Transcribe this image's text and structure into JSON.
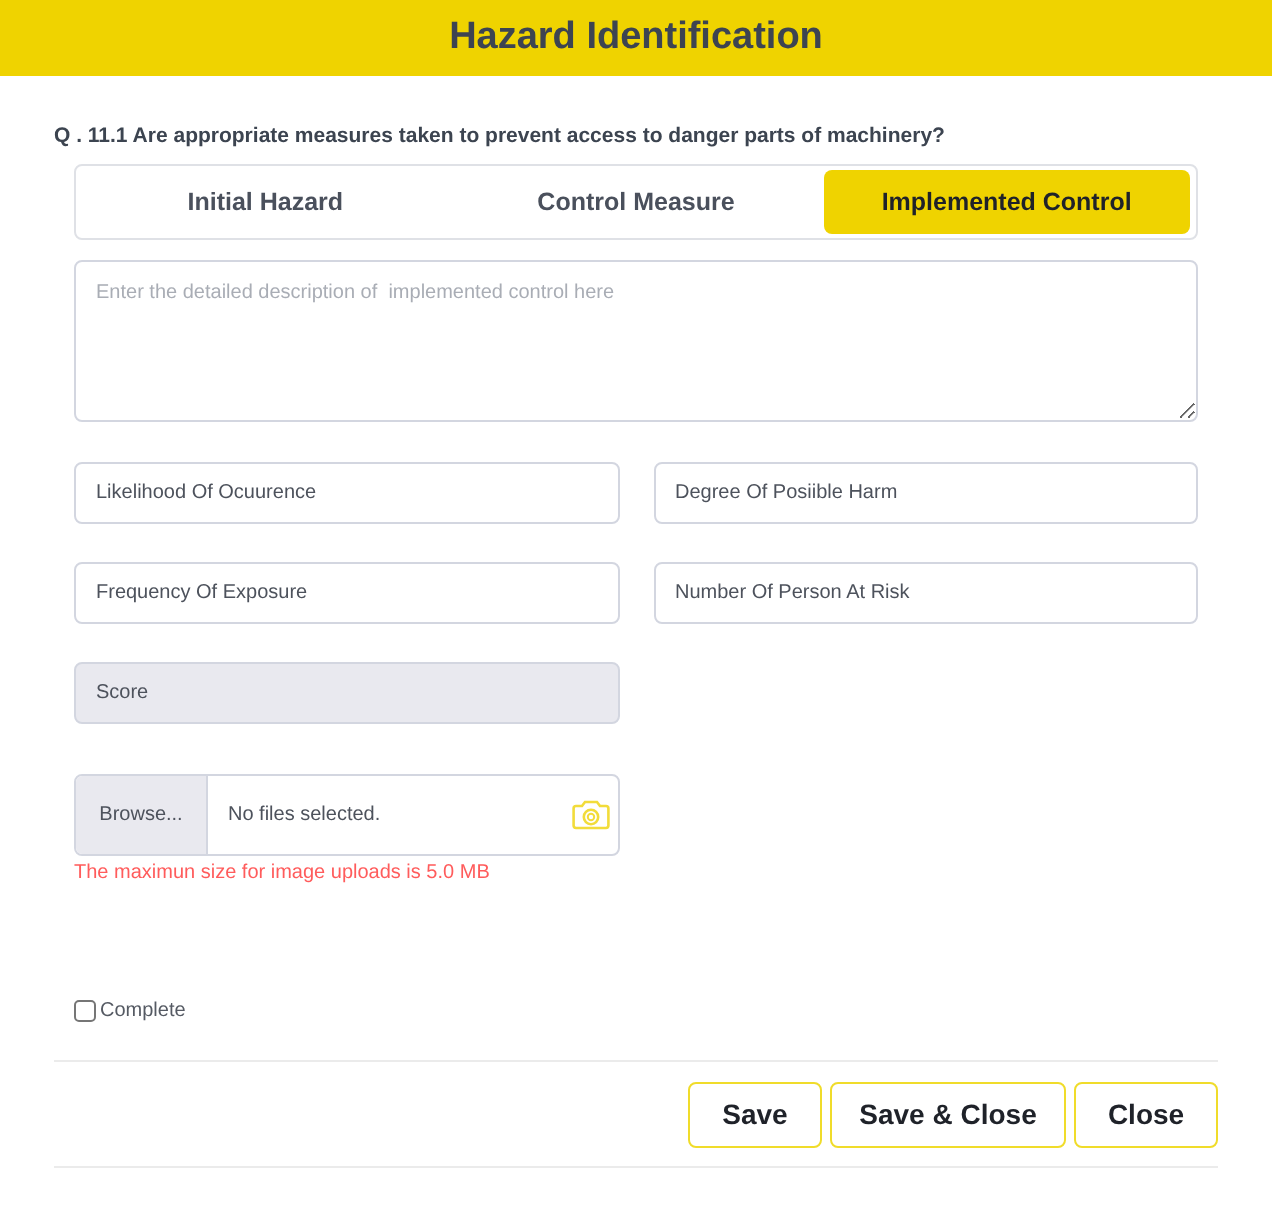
{
  "window": {
    "title": "Hazard Identification"
  },
  "question": "Q . 11.1 Are appropriate measures taken to prevent access to danger parts of machinery?",
  "tabs": [
    {
      "label": "Initial Hazard",
      "selected": false
    },
    {
      "label": "Control Measure",
      "selected": false
    },
    {
      "label": "Implemented Control",
      "selected": true
    }
  ],
  "description": {
    "placeholder": "Enter the detailed description of  implemented control here"
  },
  "fields": [
    {
      "value": "Likelihood Of Ocuurence",
      "disabled": false
    },
    {
      "value": "Degree Of Posiible Harm",
      "disabled": false
    },
    {
      "value": "Frequency Of Exposure",
      "disabled": false
    },
    {
      "value": "Number Of Person At Risk",
      "disabled": false
    },
    {
      "value": "Score",
      "disabled": true
    }
  ],
  "file_upload": {
    "button": "Browse...",
    "status": "No files selected.",
    "hint": "The maximun size for image uploads is 5.0 MB"
  },
  "complete": {
    "label": "Complete",
    "checked": false
  },
  "buttons": [
    "Save",
    "Save & Close",
    "Close"
  ]
}
